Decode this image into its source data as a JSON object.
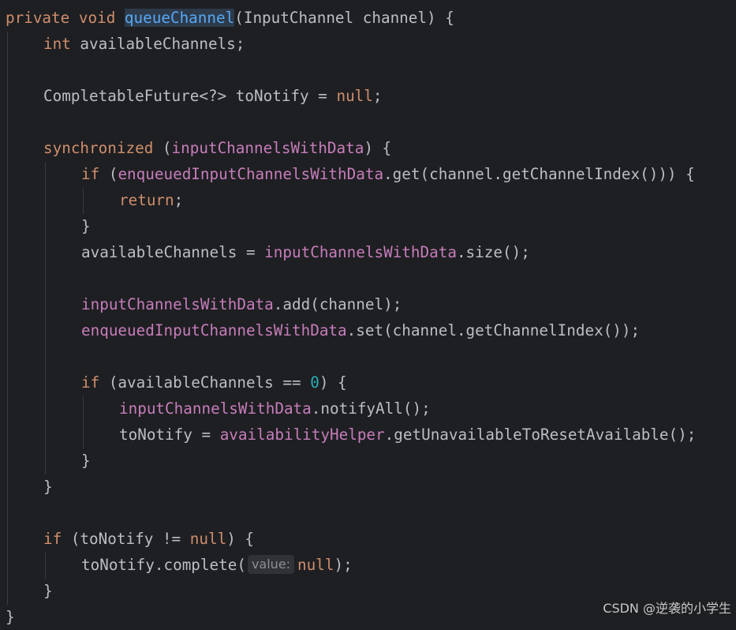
{
  "code": {
    "l1": {
      "a": "private",
      "b": " ",
      "c": "void",
      "d": " ",
      "name": "queueChannel",
      "rest": "(InputChannel channel) {"
    },
    "l2": {
      "a": "int",
      "b": " availableChannels;"
    },
    "l4": {
      "a": "CompletableFuture<?> toNotify = ",
      "b": "null",
      "c": ";"
    },
    "l6": {
      "a": "synchronized",
      "b": " (",
      "c": "inputChannelsWithData",
      "d": ") {"
    },
    "l7": {
      "a": "if",
      "b": " (",
      "c": "enqueuedInputChannelsWithData",
      "d": ".get(channel.getChannelIndex())) {"
    },
    "l8": {
      "a": "return",
      "b": ";"
    },
    "l9": {
      "a": "}"
    },
    "l10": {
      "a": "availableChannels = ",
      "b": "inputChannelsWithData",
      "c": ".size();"
    },
    "l12": {
      "a": "inputChannelsWithData",
      "b": ".add(channel);"
    },
    "l13": {
      "a": "enqueuedInputChannelsWithData",
      "b": ".set(channel.getChannelIndex());"
    },
    "l15": {
      "a": "if",
      "b": " (availableChannels == ",
      "c": "0",
      "d": ") {"
    },
    "l16": {
      "a": "inputChannelsWithData",
      "b": ".notifyAll();"
    },
    "l17": {
      "a": "toNotify = ",
      "b": "availabilityHelper",
      "c": ".getUnavailableToResetAvailable();"
    },
    "l18": {
      "a": "}"
    },
    "l19": {
      "a": "}"
    },
    "l21": {
      "a": "if",
      "b": " (toNotify != ",
      "c": "null",
      "d": ") {"
    },
    "l22": {
      "a": "toNotify.complete(",
      "hint": "value:",
      "b": "null",
      "c": ");"
    },
    "l23": {
      "a": "}"
    },
    "l24": {
      "a": "}"
    }
  },
  "watermark": "CSDN @逆袭的小学生",
  "colors": {
    "background": "#1e1f22",
    "keyword": "#cf8e6d",
    "field": "#c77dbb",
    "method_declaration": "#56a8f5",
    "number": "#2aacb8",
    "plain": "#bcbec4"
  }
}
